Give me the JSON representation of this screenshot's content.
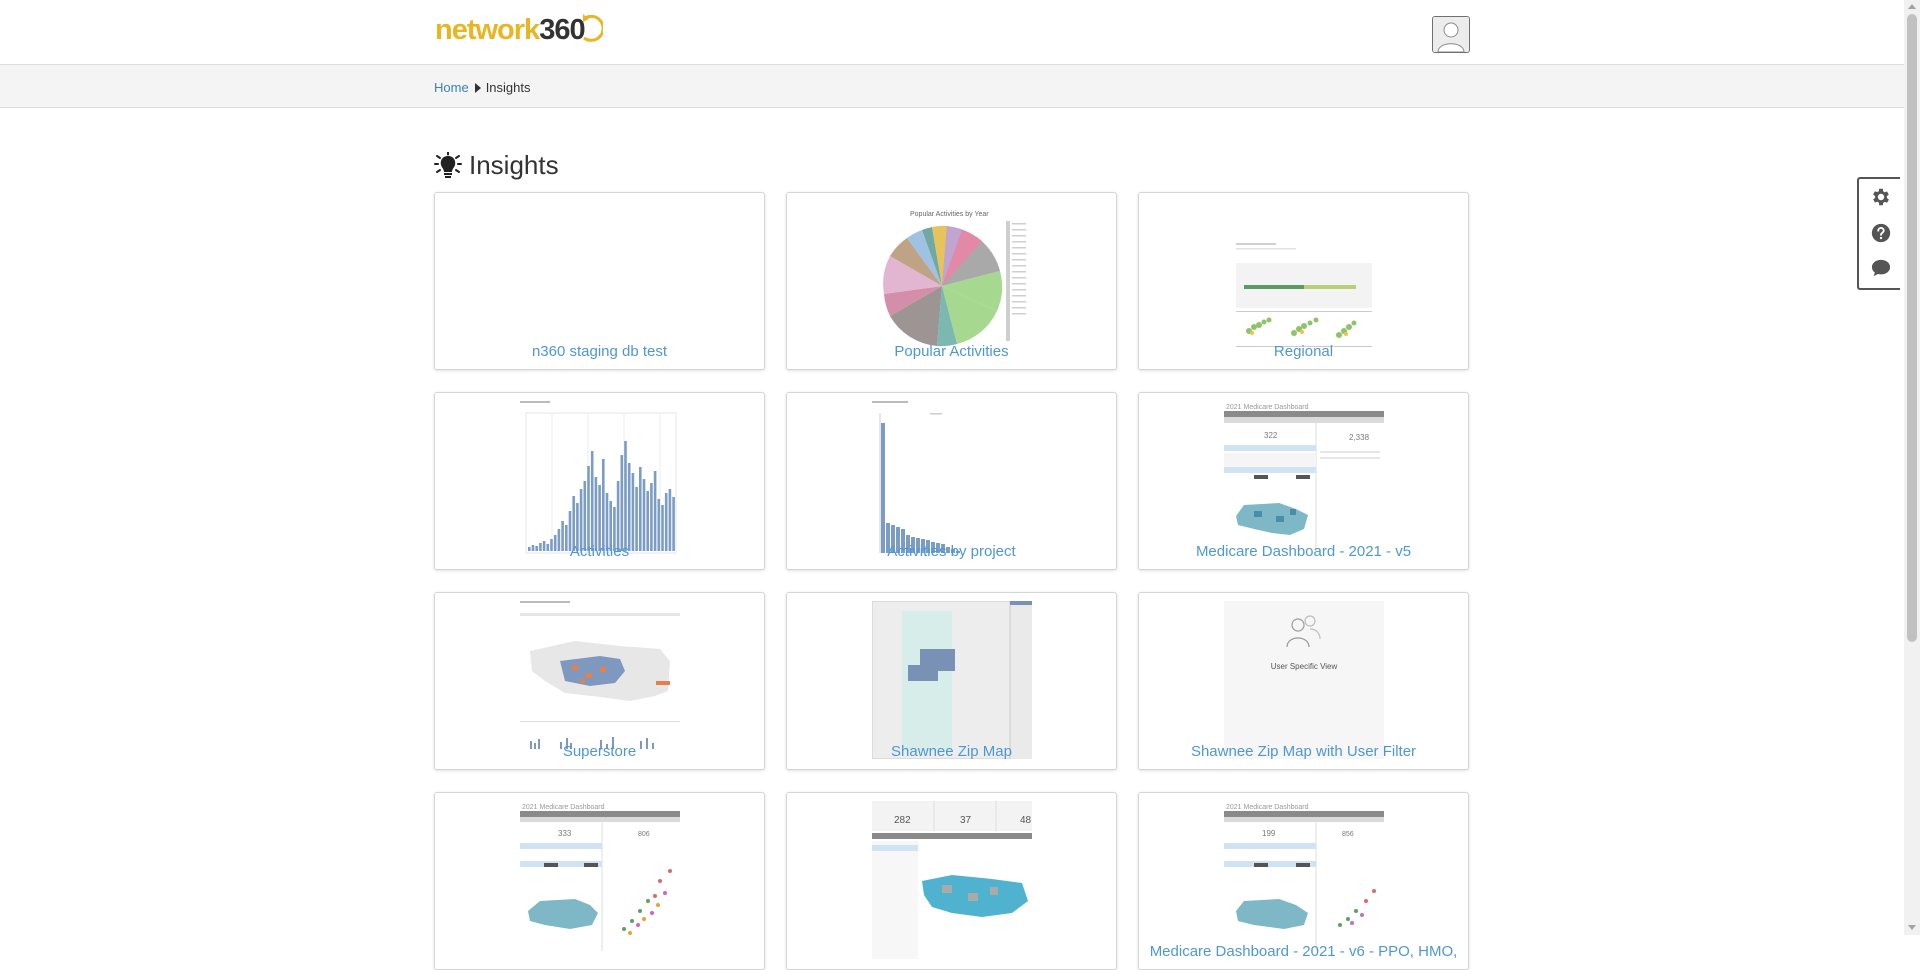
{
  "header": {
    "logo_text_main": "network",
    "logo_text_num": "360",
    "avatar_icon": "user-avatar-icon"
  },
  "breadcrumb": {
    "home": "Home",
    "current": "Insights"
  },
  "page": {
    "title": "Insights",
    "title_icon": "lightbulb-icon"
  },
  "cards": [
    {
      "label": "n360 staging db test",
      "thumb": "blank"
    },
    {
      "label": "Popular Activities",
      "thumb": "pie"
    },
    {
      "label": "Regional",
      "thumb": "regional"
    },
    {
      "label": "Activities",
      "thumb": "bars"
    },
    {
      "label": "Activities by project",
      "thumb": "project-bars"
    },
    {
      "label": "Medicare Dashboard - 2021 - v5",
      "thumb": "dashboard-map"
    },
    {
      "label": "Superstore",
      "thumb": "superstore"
    },
    {
      "label": "Shawnee Zip Map",
      "thumb": "zipmap"
    },
    {
      "label": "Shawnee Zip Map with User Filter",
      "thumb": "user-specific"
    },
    {
      "label": "",
      "thumb": "dashboard-scatter"
    },
    {
      "label": "",
      "thumb": "dashboard-counts"
    },
    {
      "label": "Medicare Dashboard - 2021 - v6 - PPO, HMO,",
      "thumb": "dashboard-scatter-2"
    }
  ],
  "thumb_text": {
    "pie_title": "Popular Activities by Year",
    "user_specific_view": "User Specific View",
    "dash_title": "2021 Medicare Dashboard",
    "dash_v5_count_1": "322",
    "dash_v5_count_2": "2,338",
    "dash_sc_count_1": "333",
    "dash_sc_count_2": "806",
    "dash_counts_1": "282",
    "dash_counts_2": "37",
    "dash_counts_3": "48",
    "dash_v6_count_1": "199",
    "dash_v6_count_2": "856"
  },
  "side_tools": [
    {
      "name": "settings",
      "icon": "gear-icon"
    },
    {
      "name": "help",
      "icon": "question-icon"
    },
    {
      "name": "chat",
      "icon": "chat-icon"
    }
  ],
  "colors": {
    "link": "#4f97d3",
    "logo_yellow": "#e8b623",
    "tableau_blue": "#7b9cc4"
  }
}
